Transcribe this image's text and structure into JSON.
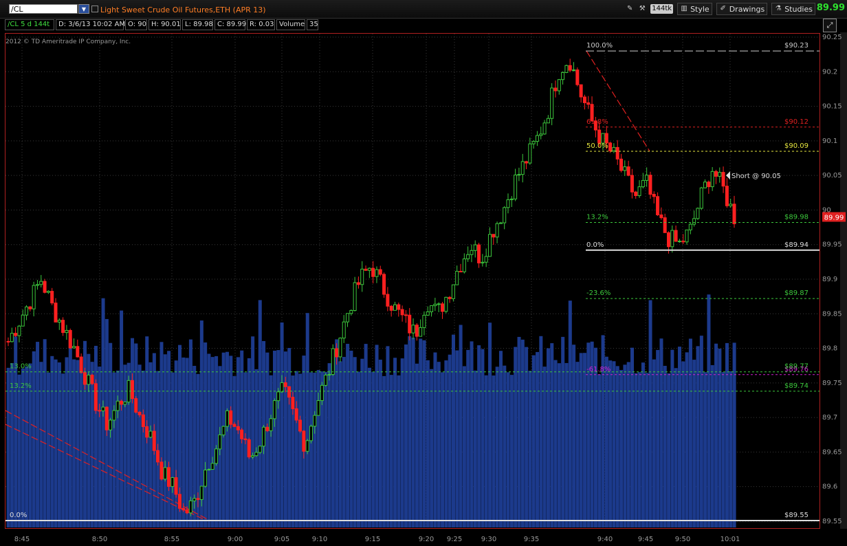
{
  "header": {
    "symbol": "/CL",
    "description": "Light Sweet Crude Oil Futures,ETH (APR 13)",
    "last_price": "89.99",
    "tools": {
      "ticks": "144tk",
      "style": "Style",
      "drawings": "Drawings",
      "studies": "Studies"
    }
  },
  "info": {
    "aggregation": "/CL 5 d 144t",
    "date": "D: 3/6/13 10:02 AM",
    "open": "O: 90",
    "high": "H: 90.01",
    "low": "L: 89.98",
    "close": "C: 89.99",
    "range": "R: 0.03",
    "volume_label": "Volume",
    "volume": "35"
  },
  "copyright": "2012 © TD Ameritrade IP Company, Inc.",
  "colors": {
    "up": "#3cc83c",
    "down": "#ff2020",
    "volume": "#1c3a8c",
    "frame": "#b02020",
    "price_tag": "#e02020"
  },
  "chart_data": {
    "type": "candlestick",
    "y_ticks": [
      "90.25",
      "90.2",
      "90.15",
      "90.1",
      "90.05",
      "90",
      "89.95",
      "89.9",
      "89.85",
      "89.8",
      "89.75",
      "89.7",
      "89.65",
      "89.6",
      "89.55"
    ],
    "x_ticks": [
      "8:45",
      "8:50",
      "8:55",
      "9:00",
      "9:05",
      "9:10",
      "9:15",
      "9:20",
      "9:25",
      "9:30",
      "9:35",
      "9:40",
      "9:45",
      "9:50",
      "10:01"
    ],
    "ylim": [
      89.54,
      90.255
    ],
    "last_price_tag": "89.99",
    "close_path": [
      89.81,
      89.84,
      89.87,
      89.9,
      89.86,
      89.83,
      89.8,
      89.76,
      89.72,
      89.69,
      89.72,
      89.74,
      89.7,
      89.67,
      89.62,
      89.6,
      89.56,
      89.58,
      89.63,
      89.66,
      89.7,
      89.68,
      89.64,
      89.67,
      89.71,
      89.74,
      89.7,
      89.66,
      89.72,
      89.76,
      89.81,
      89.86,
      89.9,
      89.92,
      89.89,
      89.86,
      89.84,
      89.82,
      89.87,
      89.85,
      89.88,
      89.92,
      89.95,
      89.93,
      89.97,
      90.0,
      90.04,
      90.07,
      90.1,
      90.14,
      90.2,
      90.22,
      90.17,
      90.13,
      90.1,
      90.08,
      90.05,
      90.02,
      90.04,
      89.99,
      89.96,
      89.95,
      89.97,
      90.02,
      90.06,
      90.03,
      89.99
    ],
    "fib_upper": [
      {
        "pct": "100.0%",
        "price": "$90.23",
        "value": 90.23,
        "color": "#cccccc"
      },
      {
        "pct": "61.8%",
        "price": "$90.12",
        "value": 90.12,
        "color": "#e02020"
      },
      {
        "pct": "50.0%",
        "price": "$90.09",
        "value": 90.085,
        "color": "#e8e840"
      },
      {
        "pct": "13.2%",
        "price": "$89.98",
        "value": 89.982,
        "color": "#3cc83c"
      },
      {
        "pct": "0.0%",
        "price": "$89.94",
        "value": 89.942,
        "color": "#dddddd"
      },
      {
        "pct": "-23.6%",
        "price": "$89.87",
        "value": 89.872,
        "color": "#3cc83c"
      },
      {
        "pct": "-61.8%",
        "price": "$89.76",
        "value": 89.762,
        "color": "#d020d0"
      }
    ],
    "fib_lower": [
      {
        "pct": "13.0%",
        "price": "$89.77",
        "value": 89.766,
        "color": "#3cc83c"
      },
      {
        "pct": "13.2%",
        "price": "$89.74",
        "value": 89.738,
        "color": "#3cc83c"
      },
      {
        "pct": "0.0%",
        "price": "$89.55",
        "value": 89.551,
        "color": "#dddddd"
      }
    ],
    "annotation": "Short @ 90.05"
  }
}
